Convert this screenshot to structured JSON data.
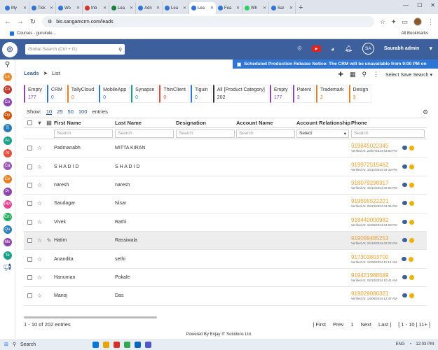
{
  "browser": {
    "tabs": [
      {
        "label": "My",
        "color": "#2f75d3"
      },
      {
        "label": "Tick",
        "color": "#2f75d3"
      },
      {
        "label": "Wo",
        "color": "#2f75d3"
      },
      {
        "label": "Inb",
        "color": "#d93025"
      },
      {
        "label": "Lea",
        "color": "#188038"
      },
      {
        "label": "Adn",
        "color": "#2f75d3"
      },
      {
        "label": "Lea",
        "color": "#2f75d3"
      },
      {
        "label": "Lea",
        "color": "#2f75d3",
        "active": true
      },
      {
        "label": "Fea",
        "color": "#2f75d3"
      },
      {
        "label": "Wh",
        "color": "#25d366"
      },
      {
        "label": "Sar",
        "color": "#2f75d3"
      }
    ],
    "url": "bis.sangamcrm.com/leads",
    "bookmark": "Courses - gurukule...",
    "all_bookmarks": "All Bookmarks"
  },
  "header": {
    "search_placeholder": "Global Search (Ctrl + G)",
    "avatar_initials": "SA",
    "user_name": "Saurabh admin"
  },
  "rail": [
    {
      "label": "Le",
      "color": "#e88b2b"
    },
    {
      "label": "Co",
      "color": "#c0392b"
    },
    {
      "label": "Co",
      "color": "#8e44ad"
    },
    {
      "label": "Op",
      "color": "#d35400"
    },
    {
      "label": "Ti",
      "color": "#2980b9"
    },
    {
      "label": "Ac",
      "color": "#16a085"
    },
    {
      "label": "At",
      "color": "#e74c3c"
    },
    {
      "label": "Ca",
      "color": "#9b59b6"
    },
    {
      "label": "Ce",
      "color": "#e67e22"
    },
    {
      "label": "Pr",
      "color": "#8e44ad"
    },
    {
      "label": "PM",
      "color": "#e84393"
    },
    {
      "label": "Em",
      "color": "#27ae60"
    },
    {
      "label": "Qu",
      "color": "#2980b9"
    },
    {
      "label": "Me",
      "color": "#8e44ad"
    },
    {
      "label": "Te",
      "color": "#16a085"
    }
  ],
  "notice": "Scheduled Production Release Notice: The CRM will be unavailable from 9:00 PM on",
  "breadcrumb": {
    "module": "Leads",
    "view": "List"
  },
  "toolbar": {
    "saved_search": "Select Save Search"
  },
  "categories": [
    {
      "name": "Empty",
      "count": "177",
      "color": "#8e44ad"
    },
    {
      "name": "CRM",
      "count": "0",
      "color": "#2f75d3"
    },
    {
      "name": "TallyCloud",
      "count": "0",
      "color": "#e67e22"
    },
    {
      "name": "MobileApp",
      "count": "0",
      "color": "#2f75d3"
    },
    {
      "name": "Synapse",
      "count": "0",
      "color": "#16a085"
    },
    {
      "name": "ThinClient",
      "count": "0",
      "color": "#e74c3c"
    },
    {
      "name": "Tiguin",
      "count": "0",
      "color": "#2f75d3"
    },
    {
      "name": "All [Product Category]",
      "count": "202",
      "color": "#333333"
    },
    {
      "name": "Empty",
      "count": "177",
      "color": "#8e44ad"
    },
    {
      "name": "Patent",
      "count": "3",
      "color": "#8e44ad"
    },
    {
      "name": "Trademark",
      "count": "2",
      "color": "#e67e22"
    },
    {
      "name": "Design",
      "count": "3",
      "color": "#e67e22"
    }
  ],
  "show": {
    "label": "Show:",
    "options": [
      "10",
      "25",
      "50",
      "100"
    ],
    "suffix": "entries"
  },
  "columns": {
    "first": "First Name",
    "last": "Last Name",
    "designation": "Designation",
    "account": "Account Name",
    "relationship": "Account Relationship",
    "phone": "Phone"
  },
  "filters": {
    "search": "Search",
    "select": "Select"
  },
  "rows": [
    {
      "first": "Padmanabh",
      "last": "MITTA KIRAN",
      "phone": "919845022345",
      "verified": "Verified At: 23/07/2024 03:53 PM"
    },
    {
      "first": "S H A D I D",
      "last": "S H A D I D",
      "phone": "919972515462",
      "verified": "Verified At: 15/12/2024 04:10 PM"
    },
    {
      "first": "naresh",
      "last": "naresh",
      "phone": "918079298317",
      "verified": "Verified At: 15/12/2024 02:05 PM"
    },
    {
      "first": "Saudagar",
      "last": "Nisar",
      "phone": "919595522221",
      "verified": "Verified At: 23/10/2024 04:36 PM"
    },
    {
      "first": "Vivek",
      "last": "Rathi",
      "phone": "918440000982",
      "verified": "Verified At: 16/09/2024 04:20 PM"
    },
    {
      "first": "Hatim",
      "last": "Rassiwala",
      "phone": "919099485253",
      "verified": "Verified At: 24/10/2024 02:22 PM",
      "highlight": true
    },
    {
      "first": "Anandita",
      "last": "sethi",
      "phone": "917303803700",
      "verified": "Verified At: 12/09/2024 11:14 AM"
    },
    {
      "first": "Hanuman",
      "last": "Pokale",
      "phone": "919421988589",
      "verified": "Verified At: 02/10/2024 10:41 AM"
    },
    {
      "first": "Manoj",
      "last": "Das",
      "phone": "919029086321",
      "verified": "Verified At: 13/09/2024 12:47 AM"
    }
  ],
  "pager": {
    "summary": "1 - 10 of 202 entries",
    "first": "| First",
    "prev": "Prev",
    "page": "1",
    "next": "Next",
    "last": "Last |",
    "range": "[ 1 - 10 | 11+ ]"
  },
  "footer": "Powered By Enjay IT Solutions Ltd.",
  "taskbar": {
    "search": "Search",
    "time": "12:03 PM",
    "date": "ENG"
  }
}
